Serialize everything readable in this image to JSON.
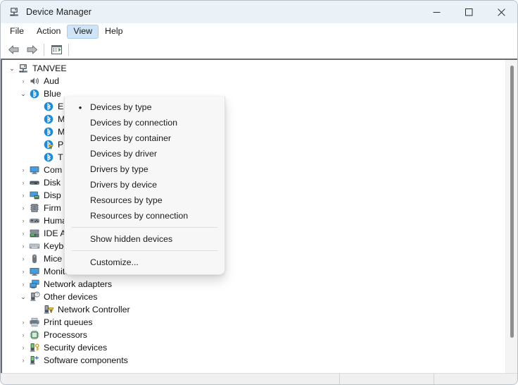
{
  "window": {
    "title": "Device Manager",
    "icon": "device-manager-icon",
    "controls": {
      "minimize": "—",
      "maximize": "☐",
      "close": "✕"
    }
  },
  "menubar": {
    "items": [
      {
        "label": "File",
        "active": false
      },
      {
        "label": "Action",
        "active": false
      },
      {
        "label": "View",
        "active": true
      },
      {
        "label": "Help",
        "active": false
      }
    ]
  },
  "toolbar": {
    "buttons": [
      {
        "name": "back-button",
        "icon": "arrow-left-icon"
      },
      {
        "name": "forward-button",
        "icon": "arrow-right-icon"
      },
      {
        "name": "properties-button",
        "icon": "properties-icon"
      }
    ]
  },
  "view_menu": {
    "items": [
      {
        "label": "Devices by type",
        "checked": true,
        "type": "item"
      },
      {
        "label": "Devices by connection",
        "checked": false,
        "type": "item"
      },
      {
        "label": "Devices by container",
        "checked": false,
        "type": "item"
      },
      {
        "label": "Devices by driver",
        "checked": false,
        "type": "item"
      },
      {
        "label": "Drivers by type",
        "checked": false,
        "type": "item"
      },
      {
        "label": "Drivers by device",
        "checked": false,
        "type": "item"
      },
      {
        "label": "Resources by type",
        "checked": false,
        "type": "item"
      },
      {
        "label": "Resources by connection",
        "checked": false,
        "type": "item"
      },
      {
        "type": "separator"
      },
      {
        "label": "Show hidden devices",
        "checked": false,
        "type": "item"
      },
      {
        "type": "separator"
      },
      {
        "label": "Customize...",
        "checked": false,
        "type": "item"
      }
    ]
  },
  "tree": {
    "nodes": [
      {
        "label": "TANVEE",
        "level": 0,
        "state": "expanded",
        "icon": "computer-icon"
      },
      {
        "label": "Aud",
        "level": 1,
        "state": "collapsed",
        "icon": "speaker-icon"
      },
      {
        "label": "Blue",
        "level": 1,
        "state": "expanded",
        "icon": "bluetooth-icon"
      },
      {
        "label": "E",
        "level": 2,
        "state": "leaf",
        "icon": "bluetooth-icon"
      },
      {
        "label": "M",
        "level": 2,
        "state": "leaf",
        "icon": "bluetooth-icon"
      },
      {
        "label": "M",
        "level": 2,
        "state": "leaf",
        "icon": "bluetooth-icon"
      },
      {
        "label": "P",
        "level": 2,
        "state": "leaf",
        "icon": "bluetooth-warning-icon"
      },
      {
        "label": "T",
        "level": 2,
        "state": "leaf",
        "icon": "bluetooth-icon"
      },
      {
        "label": "Com",
        "level": 1,
        "state": "collapsed",
        "icon": "monitor-icon"
      },
      {
        "label": "Disk",
        "level": 1,
        "state": "collapsed",
        "icon": "disk-icon"
      },
      {
        "label": "Disp",
        "level": 1,
        "state": "collapsed",
        "icon": "display-adapter-icon"
      },
      {
        "label": "Firm",
        "level": 1,
        "state": "collapsed",
        "icon": "firmware-icon"
      },
      {
        "label": "Human Interface Devices",
        "level": 1,
        "state": "collapsed",
        "icon": "gamepad-icon"
      },
      {
        "label": "IDE ATA/ATAPI controllers",
        "level": 1,
        "state": "collapsed",
        "icon": "ide-controller-icon"
      },
      {
        "label": "Keyboards",
        "level": 1,
        "state": "collapsed",
        "icon": "keyboard-icon"
      },
      {
        "label": "Mice and other pointing devices",
        "level": 1,
        "state": "collapsed",
        "icon": "mouse-icon"
      },
      {
        "label": "Monitors",
        "level": 1,
        "state": "collapsed",
        "icon": "monitor-icon"
      },
      {
        "label": "Network adapters",
        "level": 1,
        "state": "collapsed",
        "icon": "network-adapter-icon"
      },
      {
        "label": "Other devices",
        "level": 1,
        "state": "expanded",
        "icon": "unknown-device-icon"
      },
      {
        "label": "Network Controller",
        "level": 2,
        "state": "leaf",
        "icon": "device-warning-icon"
      },
      {
        "label": "Print queues",
        "level": 1,
        "state": "collapsed",
        "icon": "printer-icon"
      },
      {
        "label": "Processors",
        "level": 1,
        "state": "collapsed",
        "icon": "processor-icon"
      },
      {
        "label": "Security devices",
        "level": 1,
        "state": "collapsed",
        "icon": "security-device-icon"
      },
      {
        "label": "Software components",
        "level": 1,
        "state": "collapsed",
        "icon": "software-component-icon"
      }
    ],
    "chevron_collapsed": "›",
    "chevron_expanded": "⌄"
  },
  "statusbar": {
    "pane1": "",
    "pane2": "",
    "pane3": ""
  },
  "colors": {
    "titlebar_bg": "#eaf2f8",
    "menu_highlight": "#cfe4f7",
    "accent_blue": "#0a84d8",
    "warning_yellow": "#f5c518",
    "content_border": "#6c6c6c",
    "statusbar_bg": "#f0f0f0"
  }
}
